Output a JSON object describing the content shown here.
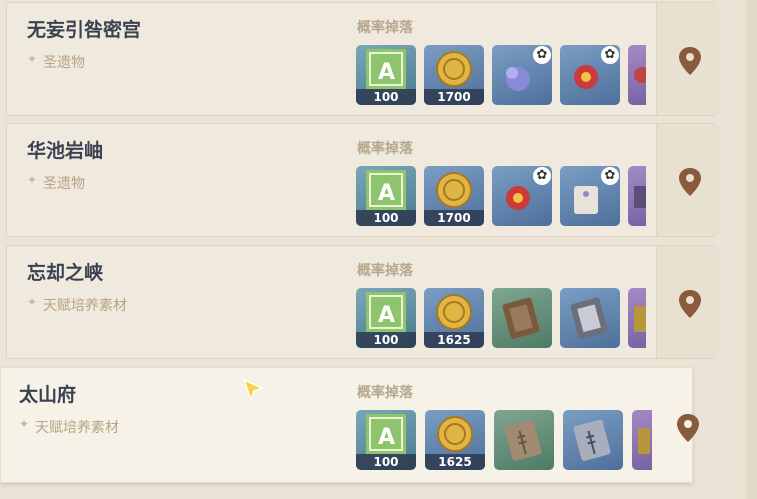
{
  "drops_label": "概率掉落",
  "domains": [
    {
      "name": "无妄引咎密宫",
      "type": "圣遗物",
      "drops": [
        {
          "icon": "adventure-exp-icon",
          "qty": "100",
          "bg": "green"
        },
        {
          "icon": "mora-coin-icon",
          "qty": "1700",
          "bg": "blue"
        },
        {
          "icon": "blue-flower-artifact-icon",
          "qty": "",
          "bg": "blue",
          "badge": "✿"
        },
        {
          "icon": "red-flower-artifact-icon",
          "qty": "",
          "bg": "blue",
          "badge": "✿"
        },
        {
          "icon": "partial-artifact-icon",
          "qty": "",
          "bg": "purple"
        }
      ]
    },
    {
      "name": "华池岩岫",
      "type": "圣遗物",
      "drops": [
        {
          "icon": "adventure-exp-icon",
          "qty": "100",
          "bg": "green"
        },
        {
          "icon": "mora-coin-icon",
          "qty": "1700",
          "bg": "blue"
        },
        {
          "icon": "red-flower-artifact-icon",
          "qty": "",
          "bg": "blue",
          "badge": "✿"
        },
        {
          "icon": "tag-artifact-icon",
          "qty": "",
          "bg": "blue",
          "badge": "✿"
        },
        {
          "icon": "partial-artifact-icon",
          "qty": "",
          "bg": "purple"
        }
      ]
    },
    {
      "name": "忘却之峡",
      "type": "天赋培养素材",
      "drops": [
        {
          "icon": "adventure-exp-icon",
          "qty": "100",
          "bg": "green"
        },
        {
          "icon": "mora-coin-icon",
          "qty": "1625",
          "bg": "blue"
        },
        {
          "icon": "talent-book-green-icon",
          "qty": "",
          "bg": "teal"
        },
        {
          "icon": "talent-book-blue-icon",
          "qty": "",
          "bg": "blue"
        },
        {
          "icon": "partial-talent-book-icon",
          "qty": "",
          "bg": "purple"
        }
      ]
    },
    {
      "name": "太山府",
      "type": "天赋培养素材",
      "drops": [
        {
          "icon": "adventure-exp-icon",
          "qty": "100",
          "bg": "green"
        },
        {
          "icon": "mora-coin-icon",
          "qty": "1625",
          "bg": "blue"
        },
        {
          "icon": "prosperity-book-green-icon",
          "qty": "",
          "bg": "teal"
        },
        {
          "icon": "prosperity-book-blue-icon",
          "qty": "",
          "bg": "blue"
        },
        {
          "icon": "partial-talent-book-icon",
          "qty": "",
          "bg": "purple"
        }
      ]
    }
  ]
}
